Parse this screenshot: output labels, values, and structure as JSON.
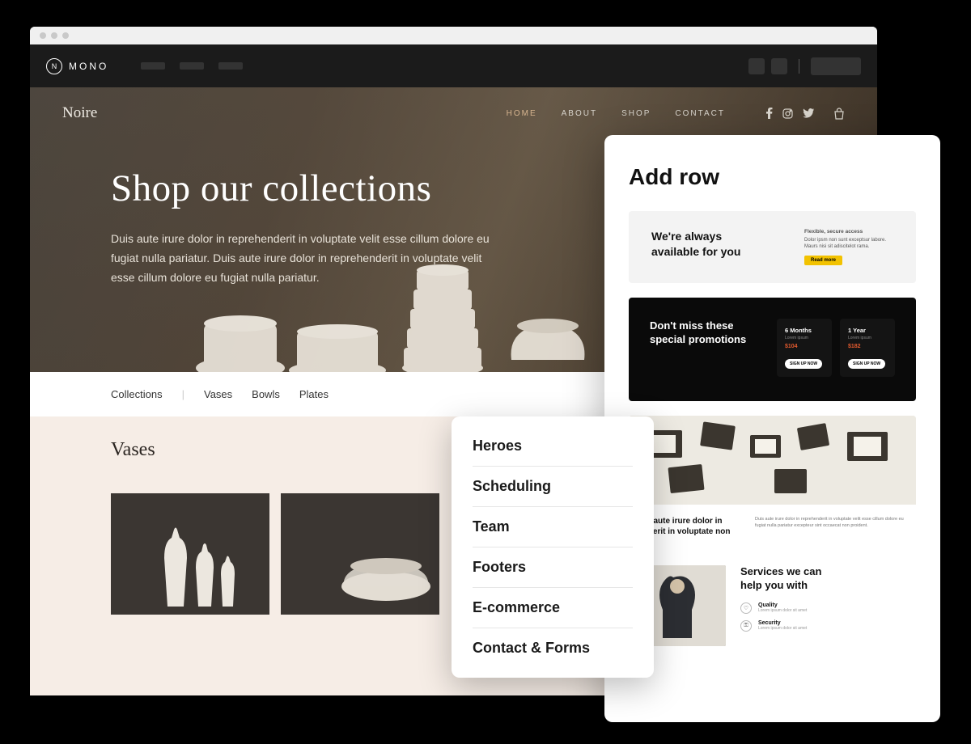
{
  "app": {
    "name": "MONO"
  },
  "site": {
    "brand": "Noire",
    "nav": [
      "HOME",
      "ABOUT",
      "SHOP",
      "CONTACT"
    ],
    "hero_title": "Shop our collections",
    "hero_body": "Duis aute irure dolor in reprehenderit in voluptate velit esse cillum dolore eu fugiat nulla pariatur. Duis aute irure dolor in reprehenderit in voluptate velit esse cillum dolore eu fugiat nulla pariatur.",
    "subnav": [
      "Collections",
      "Vases",
      "Bowls",
      "Plates"
    ],
    "section_title": "Vases"
  },
  "menu": {
    "items": [
      "Heroes",
      "Scheduling",
      "Team",
      "Footers",
      "E-commerce",
      "Contact & Forms"
    ]
  },
  "panel": {
    "title": "Add row",
    "tpl1": {
      "headline": "We're always available for you",
      "subtitle": "Flexible, secure access",
      "desc": "Dolor ipsm non sunt exceptsur labore. Maurs nisi sit adiscitelot rama.",
      "cta": "Read more"
    },
    "tpl2": {
      "headline": "Don't miss these special promotions",
      "plans": [
        {
          "title": "6 Months",
          "sub": "Lorem ipsum",
          "price": "$104",
          "cta": "SIGN UP NOW"
        },
        {
          "title": "1 Year",
          "sub": "Lorem ipsum",
          "price": "$182",
          "cta": "SIGN UP NOW"
        }
      ]
    },
    "tpl3": {
      "bold": "Duis aute irure dolor in henderit in voluptate non",
      "desc": "Duis aute irure dolor in reprehenderit in voluptate velit esse cillum dolore eu fugiat nulla pariatur excepteur sint occaecat non proident."
    },
    "tpl4": {
      "title": "Services we can help you with",
      "items": [
        {
          "label": "Quality",
          "desc": "Lorem ipsum dolor sit amet"
        },
        {
          "label": "Security",
          "desc": "Lorem ipsum dolor sit amet"
        }
      ]
    }
  }
}
